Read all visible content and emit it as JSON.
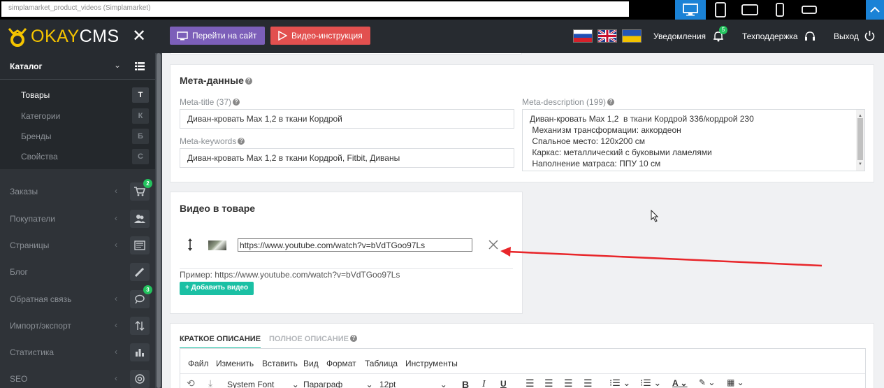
{
  "browser": {
    "url": "simplamarket_product_videos (Simplamarket)",
    "devices": [
      "desktop-icon",
      "tablet-portrait-icon",
      "tablet-landscape-icon",
      "phone-portrait-icon",
      "phone-landscape-icon"
    ]
  },
  "header": {
    "logo": "OKAYCMS",
    "go_to_site": "Перейти на сайт",
    "video_instruction": "Видео-инструкция",
    "notifications": "Уведомления",
    "notifications_count": "5",
    "support": "Техподдержка",
    "logout": "Выход"
  },
  "sidebar": {
    "catalog": "Каталог",
    "catalog_items": [
      {
        "label": "Товары",
        "key": "Т"
      },
      {
        "label": "Категории",
        "key": "К"
      },
      {
        "label": "Бренды",
        "key": "Б"
      },
      {
        "label": "Свойства",
        "key": "С"
      }
    ],
    "items": [
      {
        "label": "Заказы",
        "badge": "2"
      },
      {
        "label": "Покупатели"
      },
      {
        "label": "Страницы"
      },
      {
        "label": "Блог"
      },
      {
        "label": "Обратная связь",
        "badge": "3"
      },
      {
        "label": "Импорт/экспорт"
      },
      {
        "label": "Статистика"
      },
      {
        "label": "SEO"
      }
    ]
  },
  "meta": {
    "title": "Мета-данные",
    "meta_title_label": "Meta-title (37)",
    "meta_title_value": "Диван-кровать Max 1,2 в ткани Кордрой",
    "meta_keywords_label": "Meta-keywords",
    "meta_keywords_value": "Диван-кровать Max 1,2 в ткани Кордрой, Fitbit, Диваны",
    "meta_description_label": "Meta-description (199)",
    "meta_description_lines": [
      "Диван-кровать Max 1,2  в ткани Кордрой 336/кордрой 230",
      " Механизм трансформации: аккордеон",
      " Спальное место: 120х200 см",
      " Каркас: металлический с буковыми ламелями",
      " Наполнение матраса: ППУ 10 см"
    ]
  },
  "video": {
    "title": "Видео в товаре",
    "url": "https://www.youtube.com/watch?v=bVdTGoo97Ls",
    "example": "Пример: https://www.youtube.com/watch?v=bVdTGoo97Ls",
    "add_button": "+ Добавить видео"
  },
  "description": {
    "tab_short": "КРАТКОЕ ОПИСАНИЕ",
    "tab_full": "ПОЛНОЕ ОПИСАНИЕ",
    "menu": [
      "Файл",
      "Изменить",
      "Вставить",
      "Вид",
      "Формат",
      "Таблица",
      "Инструменты"
    ],
    "font": "System Font",
    "block": "Параграф",
    "size": "12pt"
  },
  "colors": {
    "accent_teal": "#1bc0a4",
    "purple_button": "#7c5fb9",
    "red_button": "#e2504f",
    "annotation_arrow": "#e8262a"
  }
}
